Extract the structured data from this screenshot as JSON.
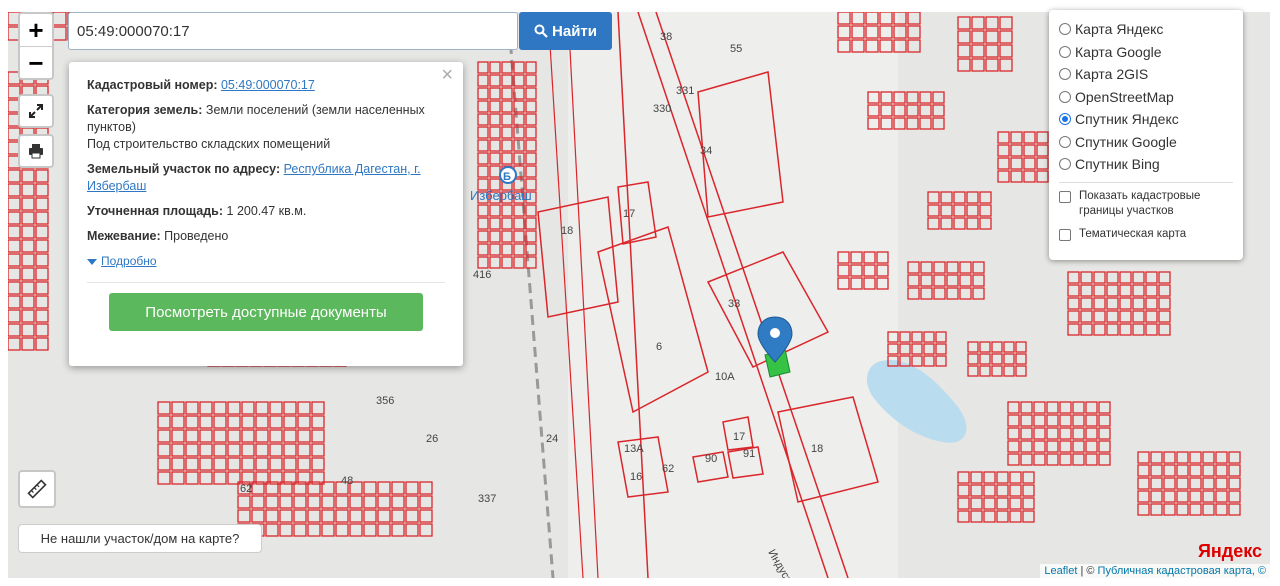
{
  "search": {
    "value": "05:49:000070:17",
    "button_label": "Найти"
  },
  "zoom": {
    "in_label": "+",
    "out_label": "−"
  },
  "popup": {
    "cadastral_label": "Кадастровый номер:",
    "cadastral_value": "05:49:000070:17",
    "category_label": "Категория земель:",
    "category_value": "Земли поселений (земли населенных пунктов)",
    "category_use": "Под строительство складских помещений",
    "address_label": "Земельный участок по адресу:",
    "address_value": "Республика Дагестан, г. Избербаш",
    "area_label": "Уточненная площадь:",
    "area_value": "1 200.47 кв.м.",
    "survey_label": "Межевание:",
    "survey_value": "Проведено",
    "more_label": "Подробно",
    "docs_button": "Посмотреть доступные документы",
    "close_symbol": "×"
  },
  "layers": {
    "options": [
      {
        "label": "Карта Яндекс",
        "selected": false
      },
      {
        "label": "Карта Google",
        "selected": false
      },
      {
        "label": "Карта 2GIS",
        "selected": false
      },
      {
        "label": "OpenStreetMap",
        "selected": false
      },
      {
        "label": "Спутник Яндекс",
        "selected": true
      },
      {
        "label": "Спутник Google",
        "selected": false
      },
      {
        "label": "Спутник Bing",
        "selected": false
      }
    ],
    "checkboxes": [
      {
        "label": "Показать кадастровые границы участков",
        "checked": false
      },
      {
        "label": "Тематическая карта",
        "checked": false
      }
    ]
  },
  "map": {
    "labels": {
      "station": "Избербаш",
      "street": "Индустри...",
      "parcels": [
        "38",
        "55",
        "330",
        "331",
        "34",
        "17",
        "18",
        "33",
        "6",
        "10А",
        "13А",
        "16",
        "62",
        "90",
        "91",
        "17",
        "18",
        "24",
        "356",
        "26",
        "48",
        "337",
        "62",
        "416"
      ]
    },
    "colors": {
      "parcel_line": "#d9262b",
      "water": "#b9dcef",
      "marker": "#2f7cc4",
      "selected_parcel": "#35c245"
    }
  },
  "not_found_label": "Не нашли участок/дом на карте?",
  "attribution": {
    "leaflet": "Leaflet",
    "sep": " | © ",
    "source": "Публичная кадастровая карта, ©"
  },
  "yandex_logo": "Яндекс"
}
